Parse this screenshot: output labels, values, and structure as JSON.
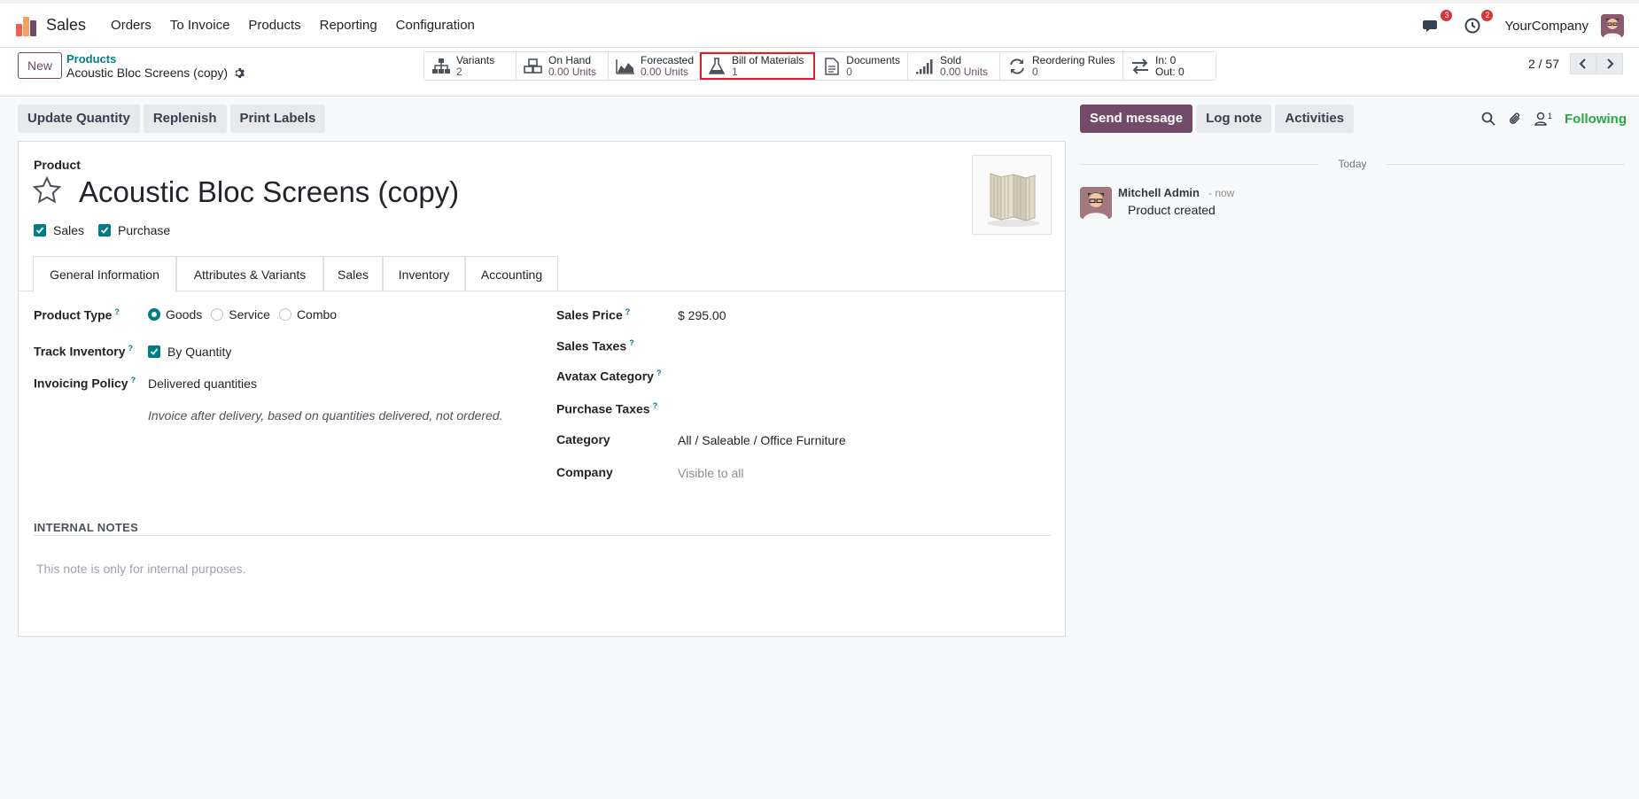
{
  "app": {
    "name": "Sales",
    "menu": [
      "Orders",
      "To Invoice",
      "Products",
      "Reporting",
      "Configuration"
    ]
  },
  "nav_right": {
    "messages_badge": "3",
    "activities_badge": "2",
    "company": "YourCompany"
  },
  "control": {
    "new_label": "New",
    "breadcrumb_parent": "Products",
    "breadcrumb_current": "Acoustic Bloc Screens (copy)",
    "pager": "2 / 57"
  },
  "stats": [
    {
      "label": "Variants",
      "value": "2",
      "icon": "sitemap-icon"
    },
    {
      "label": "On Hand",
      "value": "0.00 Units",
      "icon": "cubes-icon"
    },
    {
      "label": "Forecasted",
      "value": "0.00 Units",
      "icon": "area-chart-icon"
    },
    {
      "label": "Bill of Materials",
      "value": "1",
      "icon": "flask-icon"
    },
    {
      "label": "Documents",
      "value": "0",
      "icon": "file-icon"
    },
    {
      "label": "Sold",
      "value": "0.00 Units",
      "icon": "signal-icon"
    },
    {
      "label": "Reordering Rules",
      "value": "0",
      "icon": "refresh-icon"
    },
    {
      "label": "In: 0",
      "value": "Out: 0",
      "icon": "exchange-icon"
    }
  ],
  "actions": [
    "Update Quantity",
    "Replenish",
    "Print Labels"
  ],
  "form": {
    "product_label": "Product",
    "title": "Acoustic Bloc Screens (copy)",
    "checkboxes": [
      "Sales",
      "Purchase"
    ],
    "tabs": [
      "General Information",
      "Attributes & Variants",
      "Sales",
      "Inventory",
      "Accounting"
    ],
    "product_type_label": "Product Type",
    "product_type_options": [
      "Goods",
      "Service",
      "Combo"
    ],
    "track_inventory_label": "Track Inventory",
    "track_inventory_value": "By Quantity",
    "invoicing_policy_label": "Invoicing Policy",
    "invoicing_policy_value": "Delivered quantities",
    "invoicing_help": "Invoice after delivery, based on quantities delivered, not ordered.",
    "sales_price_label": "Sales Price",
    "sales_price_value": "$ 295.00",
    "sales_taxes_label": "Sales Taxes",
    "avatax_label": "Avatax Category",
    "purchase_taxes_label": "Purchase Taxes",
    "category_label": "Category",
    "category_value": "All / Saleable / Office Furniture",
    "company_label": "Company",
    "company_value": "Visible to all",
    "notes_heading": "INTERNAL NOTES",
    "notes_placeholder": "This note is only for internal purposes.",
    "help_mark": "?"
  },
  "chatter": {
    "send_message": "Send message",
    "log_note": "Log note",
    "activities": "Activities",
    "followers_count": "1",
    "following": "Following",
    "date_sep": "Today",
    "author": "Mitchell Admin",
    "time": "- now",
    "body": "Product created"
  },
  "colors": {
    "brand": "#714b67",
    "accent": "#017e84",
    "highlight": "#e11d2a",
    "following": "#28a745"
  }
}
